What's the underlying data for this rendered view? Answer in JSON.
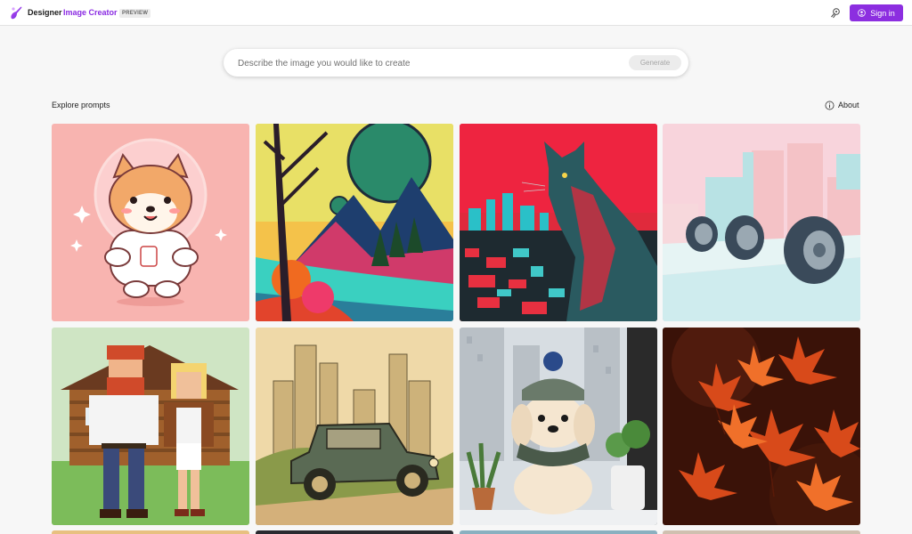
{
  "header": {
    "brand": "Designer",
    "product": "Image Creator",
    "badge": "PREVIEW",
    "sign_in_label": "Sign in",
    "icons": {
      "logo": "designer-logo-icon",
      "rewards": "rewards-icon",
      "user": "user-circle-icon"
    }
  },
  "search": {
    "placeholder": "Describe the image you would like to create",
    "value": "",
    "generate_label": "Generate"
  },
  "explore": {
    "title": "Explore prompts",
    "about_label": "About"
  },
  "gallery": [
    {
      "subject": "shiba-astronaut"
    },
    {
      "subject": "psychedelic-landscape"
    },
    {
      "subject": "cat-cityscape"
    },
    {
      "subject": "tires-city"
    },
    {
      "subject": "pixel-couple-cabin"
    },
    {
      "subject": "vintage-car-city"
    },
    {
      "subject": "crochet-dog-window"
    },
    {
      "subject": "autumn-maple-leaves"
    }
  ],
  "colors": {
    "accent": "#8c2ee0",
    "product": "#8a2be2",
    "background": "#f7f7f7"
  }
}
